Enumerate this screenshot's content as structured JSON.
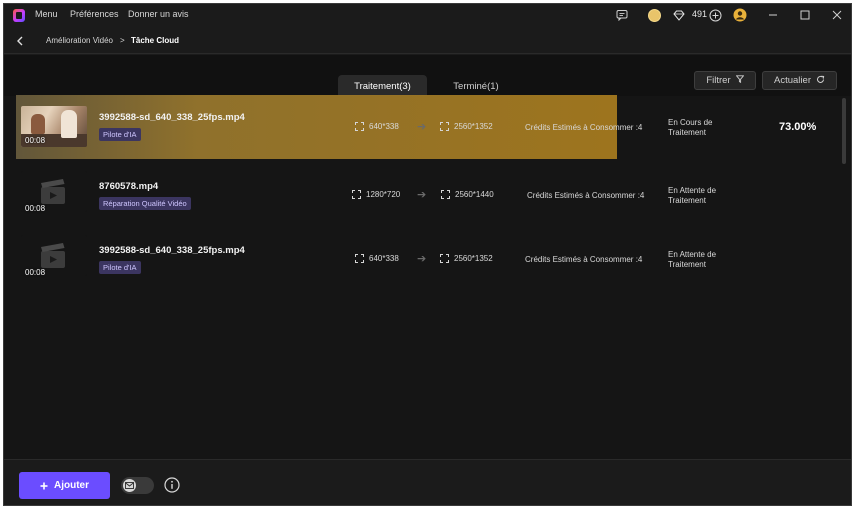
{
  "titlebar": {
    "menu": [
      "Menu",
      "Préférences",
      "Donner un avis"
    ],
    "credits": "491"
  },
  "breadcrumb": {
    "parent": "Amélioration Vidéo",
    "separator": ">",
    "current": "Tâche Cloud"
  },
  "tabs": {
    "processing": "Traitement(3)",
    "done": "Terminé(1)"
  },
  "actions": {
    "filter": "Filtrer",
    "refresh": "Actualier"
  },
  "tasks": [
    {
      "duration": "00:08",
      "file_name": "3992588-sd_640_338_25fps.mp4",
      "tag": "Pilote d'IA",
      "from_res": "640*338",
      "to_res": "2560*1352",
      "credits": "Crédits Estimés à Consommer :4",
      "status_line1": "En Cours de",
      "status_line2": "Traitement",
      "progress_text": "73.00%",
      "progress": 0.73
    },
    {
      "duration": "00:08",
      "file_name": "8760578.mp4",
      "tag": "Réparation Qualité Vidéo",
      "from_res": "1280*720",
      "to_res": "2560*1440",
      "credits": "Crédits Estimés à Consommer :4",
      "status_line1": "En Attente de",
      "status_line2": "Traitement"
    },
    {
      "duration": "00:08",
      "file_name": "3992588-sd_640_338_25fps.mp4",
      "tag": "Pilote d'IA",
      "from_res": "640*338",
      "to_res": "2560*1352",
      "credits": "Crédits Estimés à Consommer :4",
      "status_line1": "En Attente de",
      "status_line2": "Traitement"
    }
  ],
  "footer": {
    "add_label": "Ajouter"
  },
  "colors": {
    "accent": "#6b4dff",
    "progress": "#a07620",
    "tag_bg": "#3b3560"
  },
  "icons": [
    "chat-icon",
    "crown-icon",
    "diamond-icon",
    "plus-circle-icon",
    "avatar-icon",
    "back-arrow-icon",
    "filter-icon",
    "refresh-icon",
    "video-clapper-icon",
    "expand-icon",
    "arrow-right-icon",
    "plus-icon",
    "email-toggle-icon",
    "info-icon"
  ]
}
